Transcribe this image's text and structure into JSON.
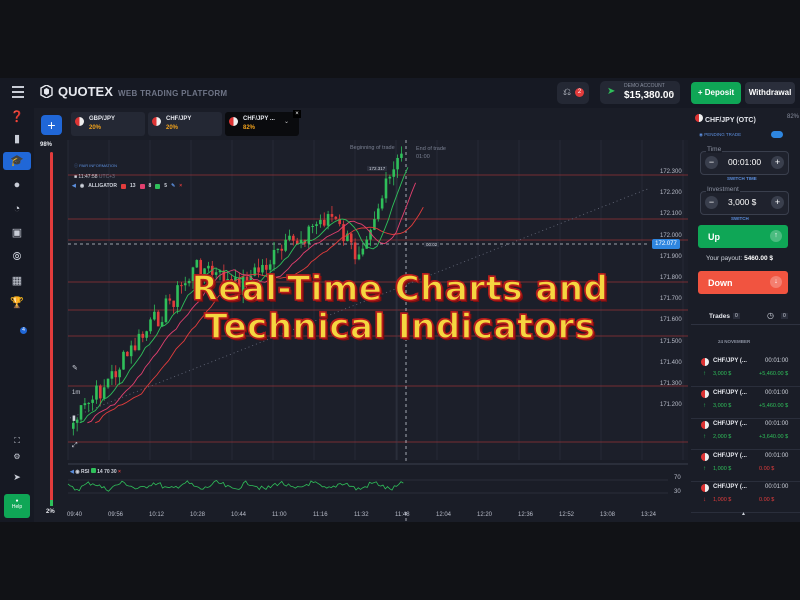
{
  "header": {
    "logo_text": "QUOTEX",
    "subtitle": "WEB TRADING PLATFORM",
    "notifications_count": "2",
    "account_label": "DEMO ACCOUNT",
    "account_balance": "$15,380.00",
    "deposit_label": "Deposit",
    "withdrawal_label": "Withdrawal"
  },
  "sidebar": {
    "official_label": "OFFICIAL",
    "help_label": "Help",
    "badge": "4"
  },
  "sentiment": {
    "top": "98%",
    "bottom": "2%"
  },
  "tabs": [
    {
      "pair": "GBP/JPY",
      "payout": "20%"
    },
    {
      "pair": "CHF/JPY",
      "payout": "20%"
    },
    {
      "pair": "CHF/JPY ...",
      "payout": "82%"
    }
  ],
  "chart": {
    "pair_info": "PAIR INFORMATION",
    "time": "11:47:58",
    "time_zone": "UTC+3",
    "indicator_name": "ALLIGATOR",
    "alligator_params": [
      "13",
      "8",
      "5"
    ],
    "begin_label": "Beginning of trade",
    "end_label": "End of trade",
    "end_time": "01:00",
    "current_price": "172.077",
    "price_tag": "00:02",
    "high_price_tag": "172.317",
    "timeframe": "1m",
    "y_labels": [
      "172.300",
      "172.200",
      "172.100",
      "172.000",
      "171.900",
      "171.800",
      "171.700",
      "171.600",
      "171.500",
      "171.400",
      "171.300",
      "171.200"
    ],
    "x_labels": [
      "09:40",
      "09:56",
      "10:12",
      "10:28",
      "10:44",
      "11:00",
      "11:16",
      "11:32",
      "11:48",
      "12:04",
      "12:20",
      "12:36",
      "12:52",
      "13:08",
      "13:24"
    ],
    "rsi_label": "RSI",
    "rsi_params": [
      "14",
      "70",
      "30"
    ],
    "rsi_levels": [
      "70",
      "30"
    ],
    "colors": {
      "up": "#2fbf5a",
      "down": "#e23c3c",
      "accent": "#2e86e0"
    }
  },
  "panel": {
    "pair": "CHF/JPY (OTC)",
    "payout_pct": "82%",
    "pending_label": "PENDING TRADE",
    "time_label": "Time",
    "time_value": "00:01:00",
    "switch_time": "SWITCH TIME",
    "investment_label": "Investment",
    "investment_value": "3,000 $",
    "switch": "SWITCH",
    "up_label": "Up",
    "payout_label": "Your payout:",
    "payout_value": "5460.00 $",
    "down_label": "Down"
  },
  "trades": {
    "title": "Trades",
    "count": "0",
    "clock_count": "0",
    "date": "24 NOVEMBER",
    "items": [
      {
        "pair": "CHF/JPY (...",
        "duration": "00:01:00",
        "direction": "up",
        "amount": "3,000 $",
        "profit": "+5,460.00 $"
      },
      {
        "pair": "CHF/JPY (...",
        "duration": "00:01:00",
        "direction": "up",
        "amount": "3,000 $",
        "profit": "+5,460.00 $"
      },
      {
        "pair": "CHF/JPY (...",
        "duration": "00:01:00",
        "direction": "up",
        "amount": "2,000 $",
        "profit": "+3,640.00 $"
      },
      {
        "pair": "CHF/JPY (...",
        "duration": "00:01:00",
        "direction": "up",
        "amount": "1,000 $",
        "profit": "0.00 $"
      },
      {
        "pair": "CHF/JPY (...",
        "duration": "00:01:00",
        "direction": "down",
        "amount": "1,000 $",
        "profit": "0.00 $"
      }
    ]
  },
  "overlay": {
    "line1": "Real-Time Charts and",
    "line2": "Technical Indicators"
  }
}
